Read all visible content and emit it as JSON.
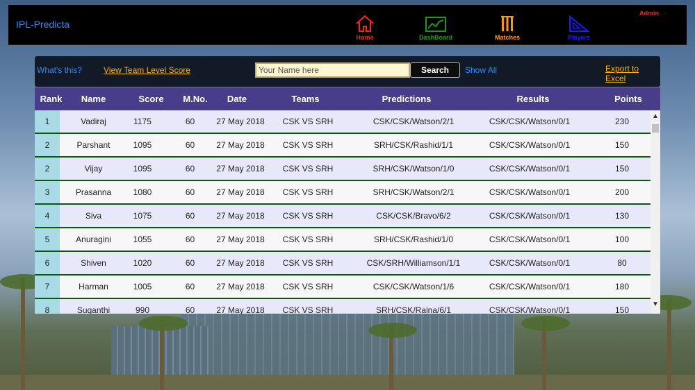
{
  "app": {
    "brand": "IPL-Predicta",
    "admin_label": "Admin"
  },
  "nav": [
    {
      "label": "Home",
      "icon": "home-icon",
      "color": "#ff1f1f"
    },
    {
      "label": "DashBoard",
      "icon": "chart-icon",
      "color": "#1a9a1a"
    },
    {
      "label": "Matches",
      "icon": "stumps-icon",
      "color": "#ff9900"
    },
    {
      "label": "Players",
      "icon": "set-square-icon",
      "color": "#1a1aff"
    }
  ],
  "toolbar": {
    "whats_this": "What's this?",
    "team_score": "View Team Level Score",
    "name_placeholder": "Your Name here",
    "name_value": "",
    "search_label": "Search",
    "show_all": "Show All",
    "export": "Export to Excel"
  },
  "table": {
    "headers": [
      "Rank",
      "Name",
      "Score",
      "M.No.",
      "Date",
      "Teams",
      "Predictions",
      "Results",
      "Points"
    ],
    "rows": [
      [
        "1",
        "Vadiraj",
        "1175",
        "60",
        "27 May 2018",
        "CSK VS SRH",
        "CSK/CSK/Watson/2/1",
        "CSK/CSK/Watson/0/1",
        "230"
      ],
      [
        "2",
        "Parshant",
        "1095",
        "60",
        "27 May 2018",
        "CSK VS SRH",
        "SRH/CSK/Rashid/1/1",
        "CSK/CSK/Watson/0/1",
        "150"
      ],
      [
        "2",
        "Vijay",
        "1095",
        "60",
        "27 May 2018",
        "CSK VS SRH",
        "SRH/CSK/Watson/1/0",
        "CSK/CSK/Watson/0/1",
        "150"
      ],
      [
        "3",
        "Prasanna",
        "1080",
        "60",
        "27 May 2018",
        "CSK VS SRH",
        "SRH/CSK/Watson/2/1",
        "CSK/CSK/Watson/0/1",
        "200"
      ],
      [
        "4",
        "Siva",
        "1075",
        "60",
        "27 May 2018",
        "CSK VS SRH",
        "CSK/CSK/Bravo/6/2",
        "CSK/CSK/Watson/0/1",
        "130"
      ],
      [
        "5",
        "Anuragini",
        "1055",
        "60",
        "27 May 2018",
        "CSK VS SRH",
        "SRH/CSK/Rashid/1/0",
        "CSK/CSK/Watson/0/1",
        "100"
      ],
      [
        "6",
        "Shiven",
        "1020",
        "60",
        "27 May 2018",
        "CSK VS SRH",
        "CSK/SRH/Williamson/1/1",
        "CSK/CSK/Watson/0/1",
        "80"
      ],
      [
        "7",
        "Harman",
        "1005",
        "60",
        "27 May 2018",
        "CSK VS SRH",
        "CSK/CSK/Watson/1/6",
        "CSK/CSK/Watson/0/1",
        "180"
      ],
      [
        "8",
        "Suganthi",
        "990",
        "60",
        "27 May 2018",
        "CSK VS SRH",
        "SRH/CSK/Raina/6/1",
        "CSK/CSK/Watson/0/1",
        "150"
      ]
    ]
  },
  "colors": {
    "header_bg": "#483d8b",
    "row_odd": "#e8e8fb",
    "row_even": "#f7f7f7",
    "rank_cell": "#a9dbe6",
    "row_border": "#0a5a0a"
  }
}
